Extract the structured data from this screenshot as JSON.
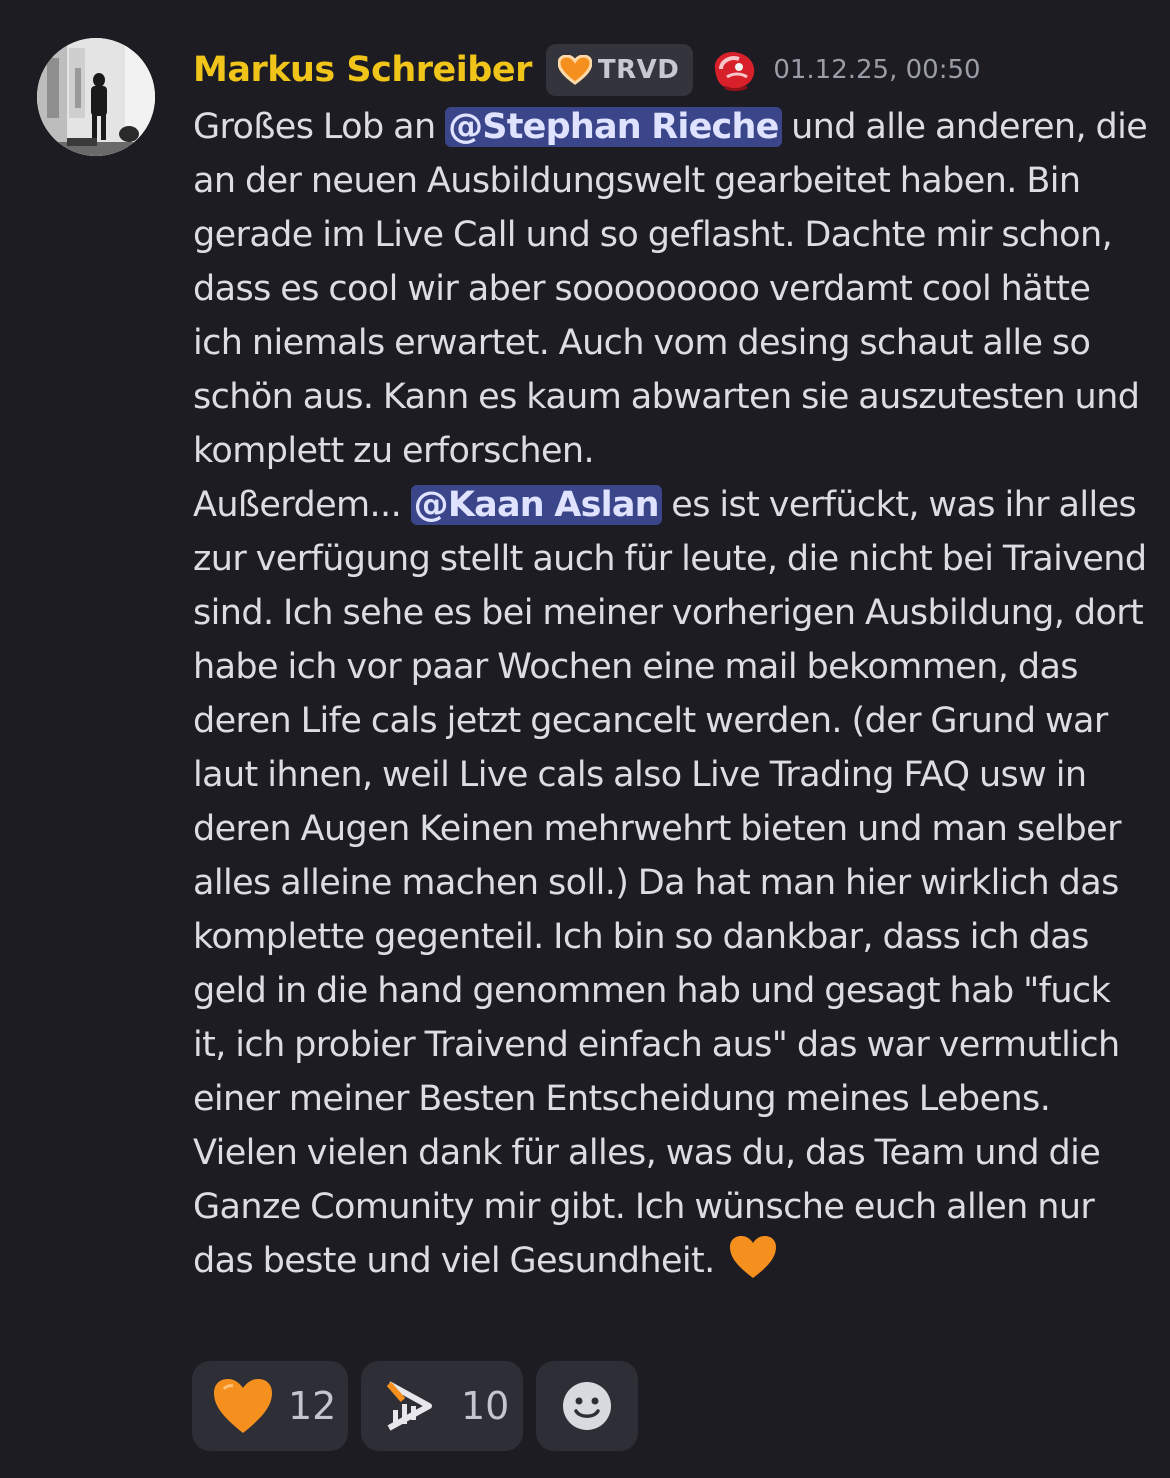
{
  "message": {
    "author": "Markus Schreiber",
    "tag": "TRVD",
    "tag_icon": "orange-heart-icon",
    "role_icon": "meat-icon",
    "timestamp": "01.12.25, 00:50",
    "body": {
      "t1": "Großes Lob an ",
      "mention1": "@Stephan Rieche",
      "t2": " und alle anderen, die an der neuen Ausbildungswelt gearbeitet haben. Bin gerade im Live Call und so geflasht. Dachte mir schon, dass es cool wir aber sooooooooo verdamt cool hätte ich niemals erwartet. Auch vom desing schaut alle so schön aus. Kann es kaum abwarten sie auszutesten und komplett zu erforschen.",
      "t3": "Außerdem... ",
      "mention2": "@Kaan Aslan",
      "t4": " es ist verfückt, was ihr alles zur verfügung stellt auch für leute, die nicht bei Traivend sind. Ich sehe es bei meiner vorherigen Ausbildung, dort habe ich vor paar Wochen eine mail bekommen, das deren Life cals jetzt gecancelt werden. (der Grund war laut ihnen, weil Live cals also Live Trading FAQ usw in deren Augen Keinen mehrwehrt bieten und man selber alles alleine machen soll.) Da hat man hier wirklich das komplette gegenteil. Ich bin so dankbar, dass ich das geld in die hand genommen hab und gesagt hab \"fuck it, ich probier Traivend einfach aus\" das war vermutlich einer meiner Besten Entscheidung meines Lebens. Vielen vielen dank für alles, was du, das Team und die Ganze Comunity mir gibt. Ich wünsche euch allen nur das beste und viel Gesundheit. ",
      "trailing_icon": "orange-heart-icon"
    },
    "reactions": [
      {
        "icon": "orange-heart-icon",
        "count": "12"
      },
      {
        "icon": "traivend-logo-icon",
        "count": "10"
      },
      {
        "icon": "add-reaction-icon"
      }
    ]
  },
  "colors": {
    "background": "#1c1c22",
    "username": "#f0c419",
    "mention_bg": "#3b4589",
    "reaction_bg": "#2e2f36",
    "accent_orange": "#f5901e"
  }
}
